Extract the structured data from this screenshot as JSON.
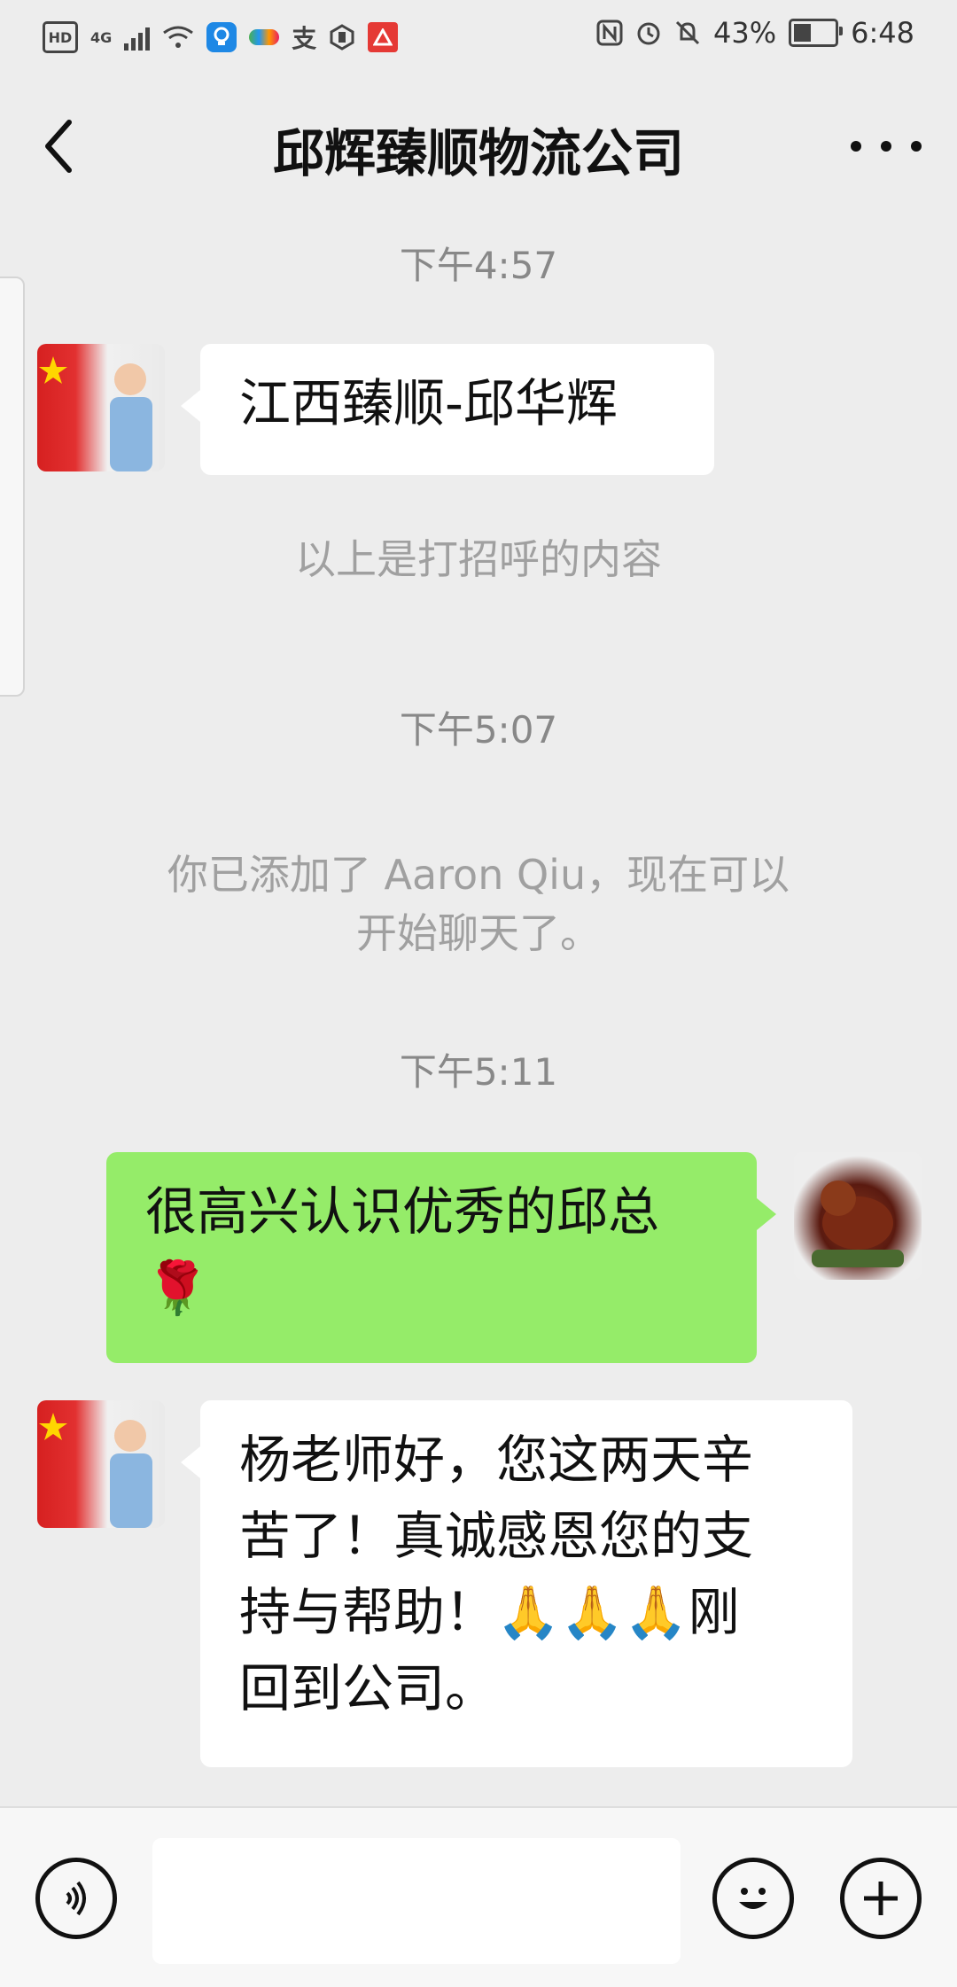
{
  "status_bar": {
    "hd": "HD",
    "network": "4G",
    "alipay_glyph": "支",
    "battery_text": "43%",
    "battery_level": 0.43,
    "time": "6:48",
    "icons": [
      "hd-icon",
      "signal-icon",
      "wifi-icon",
      "bulb-app-icon",
      "app-icon",
      "alipay-icon",
      "hand-icon",
      "app-red-icon",
      "nfc-icon",
      "alarm-icon",
      "mute-icon",
      "battery-icon"
    ]
  },
  "header": {
    "title": "邱辉臻顺物流公司",
    "back_icon": "back-chevron-icon",
    "more_icon": "more-dots-icon"
  },
  "messages": {
    "t1": "下午4:57",
    "m1": "江西臻顺-邱华辉",
    "sys1": "以上是打招呼的内容",
    "t2": "下午5:07",
    "sys2_line1": "你已添加了 Aaron Qiu，现在可以",
    "sys2_line2": "开始聊天了。",
    "t3": "下午5:11",
    "m2_line1": "很高兴认识优秀的邱总",
    "m2_line2": "🌹",
    "m3_line1": "杨老师好，您这两天辛",
    "m3_line2": "苦了！真诚感恩您的支",
    "m3_line3": "持与帮助！🙏🙏🙏刚",
    "m3_line4": "回到公司。"
  },
  "input_bar": {
    "voice_icon": "voice-icon",
    "emoji_icon": "emoji-icon",
    "plus_icon": "plus-icon",
    "input_value": ""
  },
  "colors": {
    "background": "#ededed",
    "outgoing_bubble": "#95ec69",
    "incoming_bubble": "#ffffff"
  }
}
